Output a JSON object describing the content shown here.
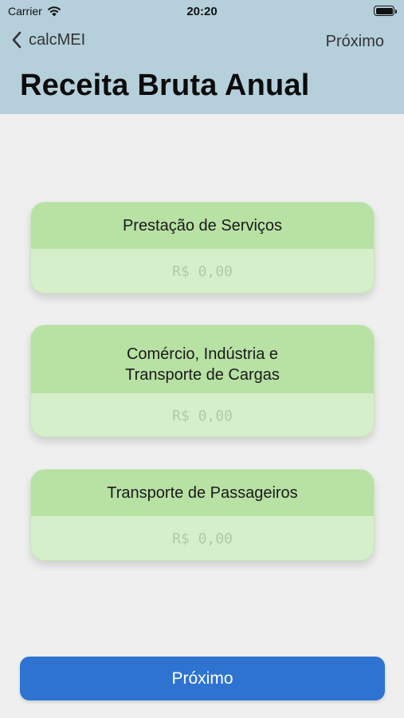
{
  "status_bar": {
    "carrier": "Carrier",
    "time": "20:20"
  },
  "nav": {
    "back_label": "calcMEI",
    "next_label": "Próximo"
  },
  "page": {
    "title": "Receita Bruta Anual"
  },
  "cards": [
    {
      "title": "Prestação de Serviços",
      "placeholder": "R$ 0,00"
    },
    {
      "title_line1": "Comércio, Indústria e",
      "title_line2": "Transporte de Cargas",
      "placeholder": "R$ 0,00"
    },
    {
      "title": "Transporte de Passageiros",
      "placeholder": "R$ 0,00"
    }
  ],
  "footer": {
    "button_label": "Próximo"
  },
  "colors": {
    "header_bg": "#b5d0db",
    "card_head": "#b8e1a4",
    "card_body": "#d6efcb",
    "button": "#2e73d0"
  }
}
